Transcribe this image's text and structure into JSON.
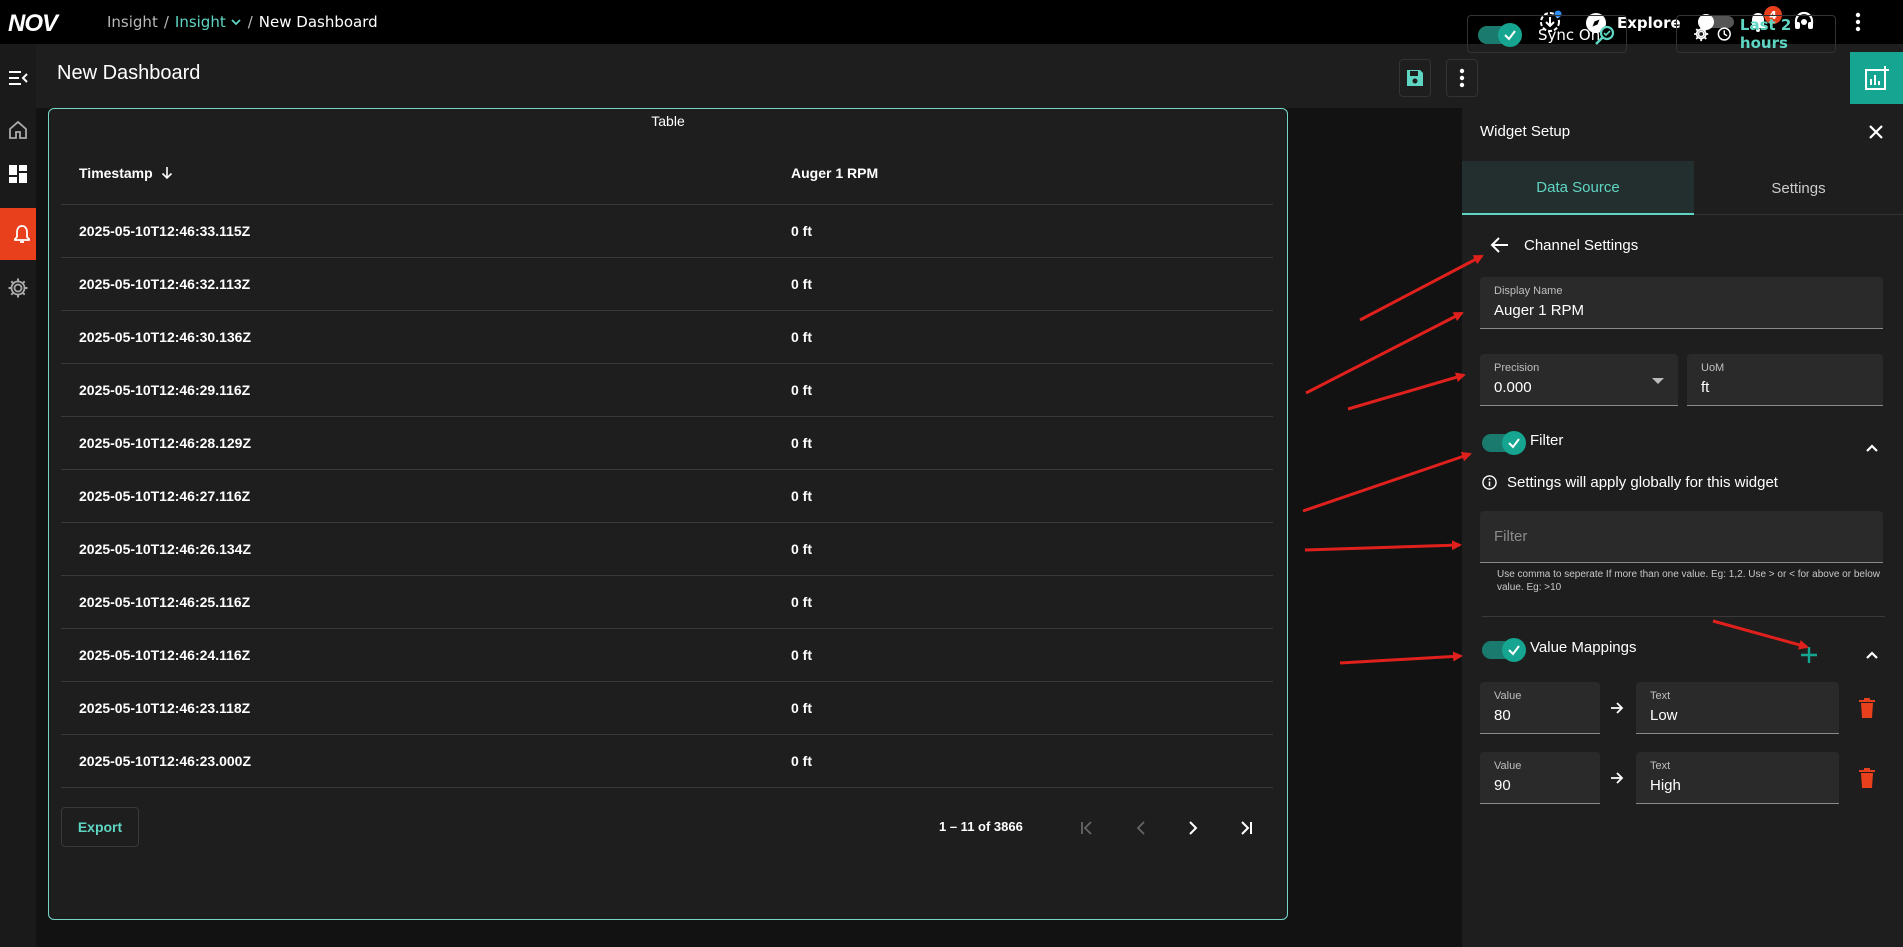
{
  "topbar": {
    "logo_text": "NOV",
    "breadcrumb_root": "Insight",
    "breadcrumb_sep": "/",
    "breadcrumb_current": "Insight",
    "breadcrumb_page": "New Dashboard",
    "explore_label": "Explore",
    "notification_count": "4"
  },
  "header": {
    "title": "New Dashboard",
    "sync_label": "Sync On",
    "time_range_label": "Last 2 hours"
  },
  "table": {
    "title": "Table",
    "columns": [
      "Timestamp",
      "Auger 1 RPM"
    ],
    "rows": [
      [
        "2025-05-10T12:46:33.115Z",
        "0 ft"
      ],
      [
        "2025-05-10T12:46:32.113Z",
        "0 ft"
      ],
      [
        "2025-05-10T12:46:30.136Z",
        "0 ft"
      ],
      [
        "2025-05-10T12:46:29.116Z",
        "0 ft"
      ],
      [
        "2025-05-10T12:46:28.129Z",
        "0 ft"
      ],
      [
        "2025-05-10T12:46:27.116Z",
        "0 ft"
      ],
      [
        "2025-05-10T12:46:26.134Z",
        "0 ft"
      ],
      [
        "2025-05-10T12:46:25.116Z",
        "0 ft"
      ],
      [
        "2025-05-10T12:46:24.116Z",
        "0 ft"
      ],
      [
        "2025-05-10T12:46:23.118Z",
        "0 ft"
      ],
      [
        "2025-05-10T12:46:23.000Z",
        "0 ft"
      ]
    ],
    "export_label": "Export",
    "range_label": "1 – 11 of 3866"
  },
  "panel": {
    "title": "Widget Setup",
    "tabs": [
      "Data Source",
      "Settings"
    ],
    "back_label": "Channel Settings",
    "display_name_label": "Display Name",
    "display_name_value": "Auger 1 RPM",
    "precision_label": "Precision",
    "precision_value": "0.000",
    "uom_label": "UoM",
    "uom_value": "ft",
    "filter_label": "Filter",
    "info_text": "Settings will apply globally for this widget",
    "filter_placeholder": "Filter",
    "filter_hint": "Use comma to seperate If more than one value. Eg: 1,2. Use > or < for above or below value. Eg: >10",
    "value_mappings_label": "Value Mappings",
    "mappings": [
      {
        "value_label": "Value",
        "value": "80",
        "text_label": "Text",
        "text": "Low"
      },
      {
        "value_label": "Value",
        "value": "90",
        "text_label": "Text",
        "text": "High"
      }
    ]
  },
  "colors": {
    "accent": "#5fd6c4",
    "accent_dark": "#16a590",
    "alert": "#e8401c",
    "annotation": "#e0201c"
  }
}
